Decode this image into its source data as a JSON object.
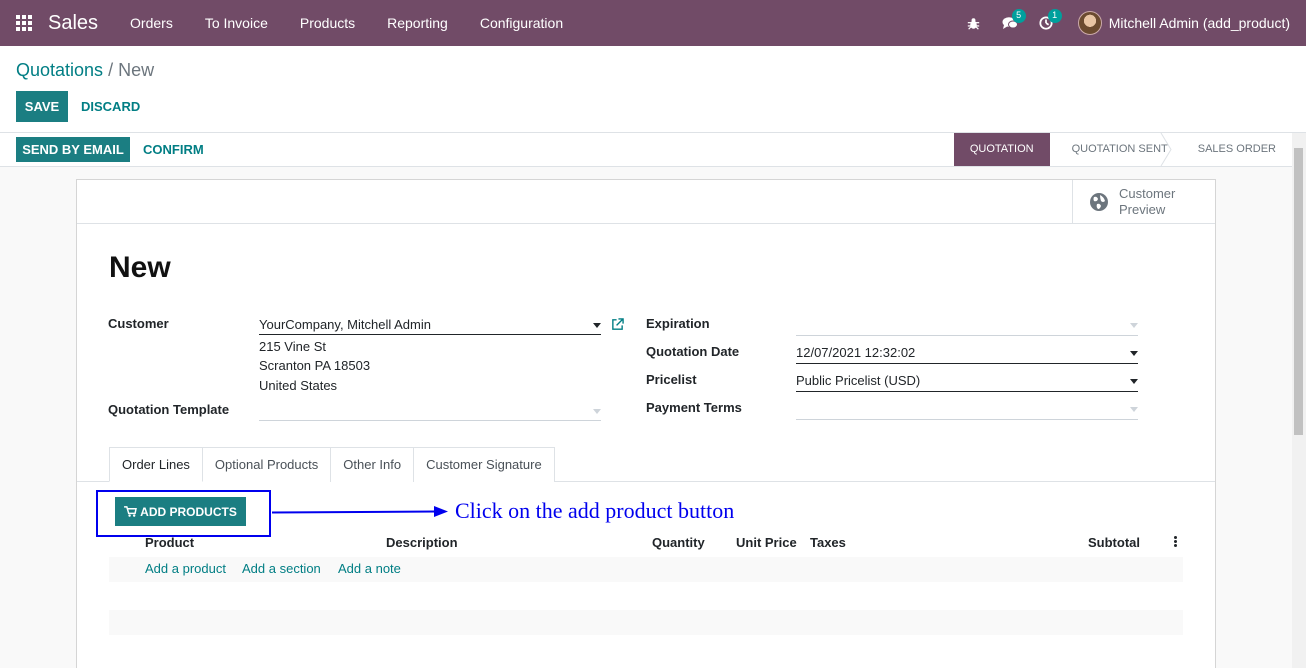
{
  "navbar": {
    "brand": "Sales",
    "menu": [
      "Orders",
      "To Invoice",
      "Products",
      "Reporting",
      "Configuration"
    ],
    "messages_badge": "5",
    "activities_badge": "1",
    "user": "Mitchell Admin (add_product)",
    "icons": [
      "apps-grid-icon",
      "bug-icon",
      "chat-icon",
      "clock-icon"
    ]
  },
  "breadcrumb": {
    "parent": "Quotations",
    "separator": " / ",
    "current": "New"
  },
  "control": {
    "save": "SAVE",
    "discard": "DISCARD"
  },
  "statusbar": {
    "send_email": "SEND BY EMAIL",
    "confirm": "CONFIRM",
    "stages": [
      "QUOTATION",
      "QUOTATION SENT",
      "SALES ORDER"
    ],
    "active_stage": "QUOTATION"
  },
  "sheet": {
    "preview_button": "Customer Preview",
    "title": "New",
    "left_fields": {
      "customer_label": "Customer",
      "customer_value": "YourCompany, Mitchell Admin",
      "address": [
        "215 Vine St",
        "Scranton PA 18503",
        "United States"
      ],
      "template_label": "Quotation Template",
      "template_value": ""
    },
    "right_fields": {
      "expiration_label": "Expiration",
      "expiration_value": "",
      "date_label": "Quotation Date",
      "date_value": "12/07/2021 12:32:02",
      "pricelist_label": "Pricelist",
      "pricelist_value": "Public Pricelist (USD)",
      "terms_label": "Payment Terms",
      "terms_value": ""
    },
    "tabs": [
      "Order Lines",
      "Optional Products",
      "Other Info",
      "Customer Signature"
    ],
    "active_tab": "Order Lines",
    "add_products": "ADD PRODUCTS",
    "columns": [
      "Product",
      "Description",
      "Quantity",
      "Unit Price",
      "Taxes",
      "Subtotal"
    ],
    "add_links": [
      "Add a product",
      "Add a section",
      "Add a note"
    ]
  },
  "annotation": {
    "text": "Click on the add product button",
    "color": "#0000ee"
  },
  "colors": {
    "brand": "#714b67",
    "primary": "#1b7e82",
    "link": "#017e84"
  }
}
